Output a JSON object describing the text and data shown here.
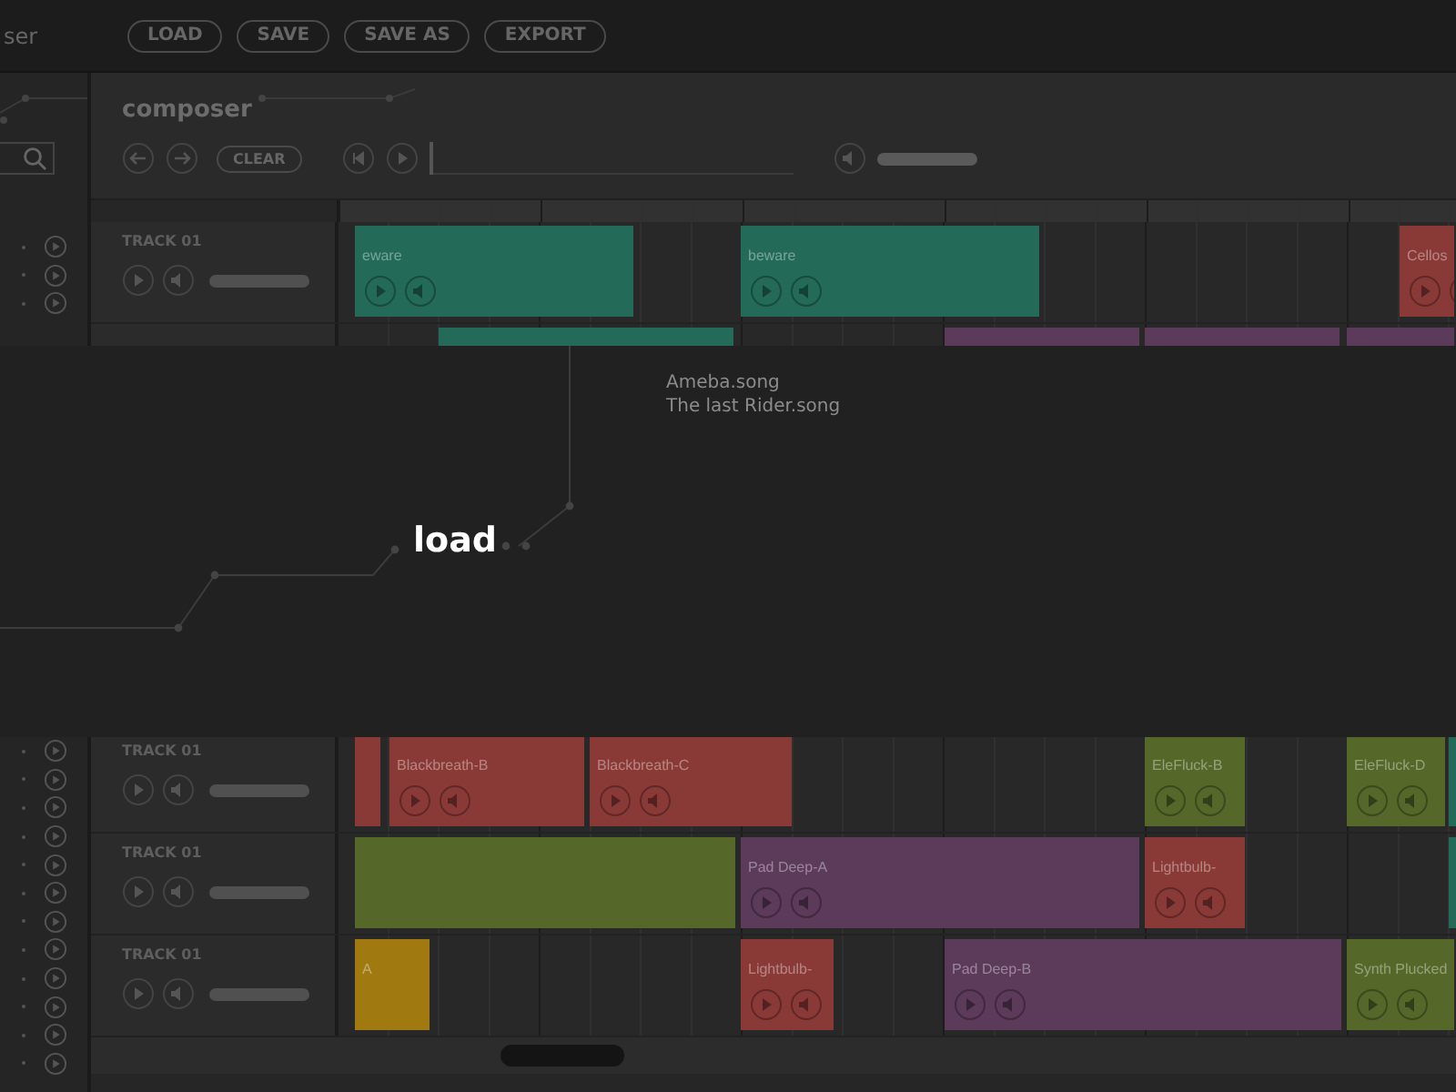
{
  "topbar": {
    "title": "ser",
    "buttons": [
      "LOAD",
      "SAVE",
      "SAVE AS",
      "EXPORT"
    ]
  },
  "composer": {
    "title": "composer",
    "clear_button": "CLEAR",
    "position": {
      "level": 0
    }
  },
  "tracks": [
    {
      "label": "TRACK 01",
      "clips": [
        {
          "name": "eware",
          "color": "#236b58",
          "controls": true
        },
        {
          "name": "beware",
          "color": "#236b58",
          "controls": true
        },
        {
          "name": "Cellos",
          "color": "#8a3a36",
          "controls": true
        }
      ]
    },
    {
      "clips": [
        {
          "color": "#236b58"
        },
        {
          "color": "#5c3a5a"
        },
        {
          "color": "#5c3a5a"
        },
        {
          "color": "#5c3a5a"
        }
      ]
    },
    {
      "label": "TRACK 01",
      "clips": [
        {
          "color": "#8a3a36",
          "controls": false
        },
        {
          "name": "Blackbreath-B",
          "color": "#8a3a36",
          "controls": true
        },
        {
          "name": "Blackbreath-C",
          "color": "#8a3a36",
          "controls": true
        },
        {
          "name": "EleFluck-B",
          "color": "#56672a",
          "controls": true
        },
        {
          "name": "EleFluck-D",
          "color": "#56672a",
          "controls": true
        },
        {
          "color": "#236b58"
        }
      ]
    },
    {
      "label": "TRACK 01",
      "clips": [
        {
          "color": "#56672a",
          "controls": false
        },
        {
          "name": "Pad Deep-A",
          "color": "#5c3a5a",
          "controls": true
        },
        {
          "name": "Lightbulb-",
          "color": "#8a3a36",
          "controls": true
        },
        {
          "color": "#236b58"
        }
      ]
    },
    {
      "label": "TRACK 01",
      "clips": [
        {
          "name": "A",
          "color": "#a07a10",
          "controls": false
        },
        {
          "name": "Lightbulb-",
          "color": "#8a3a36",
          "controls": true
        },
        {
          "name": "Pad Deep-B",
          "color": "#5c3a5a",
          "controls": true
        },
        {
          "name": "Synth Plucked",
          "color": "#56672a",
          "controls": true
        }
      ]
    }
  ],
  "load_dialog": {
    "title": "load",
    "files": [
      "Ameba.song",
      "The last Rider.song"
    ]
  }
}
